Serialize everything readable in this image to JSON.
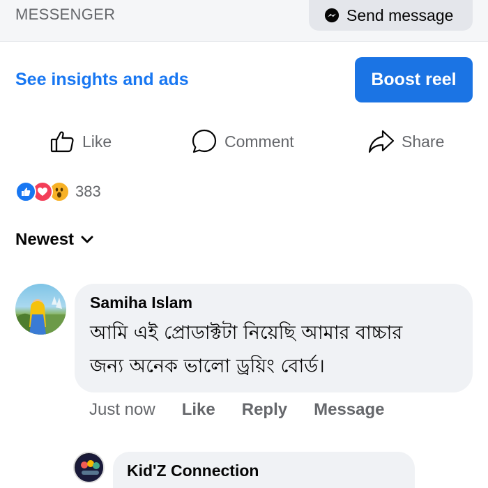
{
  "header": {
    "section_label": "MESSENGER",
    "send_message_label": "Send message"
  },
  "promo": {
    "insights_link": "See insights and ads",
    "boost_label": "Boost reel"
  },
  "actions": {
    "like": "Like",
    "comment": "Comment",
    "share": "Share"
  },
  "reactions": {
    "types": [
      "like",
      "love",
      "wow"
    ],
    "count": "383"
  },
  "sort": {
    "label": "Newest"
  },
  "comments": [
    {
      "author": "Samiha Islam",
      "text_line1": "আমি এই প্রোডাক্টটা নিয়েছি আমার বাচ্চার",
      "text_line2": "জন্য অনেক ভালো ড্রয়িং বোর্ড।",
      "time": "Just now",
      "like": "Like",
      "reply": "Reply",
      "message": "Message"
    }
  ],
  "reply": {
    "author": "Kid'Z Connection"
  },
  "colors": {
    "accent": "#1877f2",
    "boost_bg": "#1b74e4",
    "muted_text": "#65676b",
    "bubble_bg": "#f0f2f5"
  }
}
